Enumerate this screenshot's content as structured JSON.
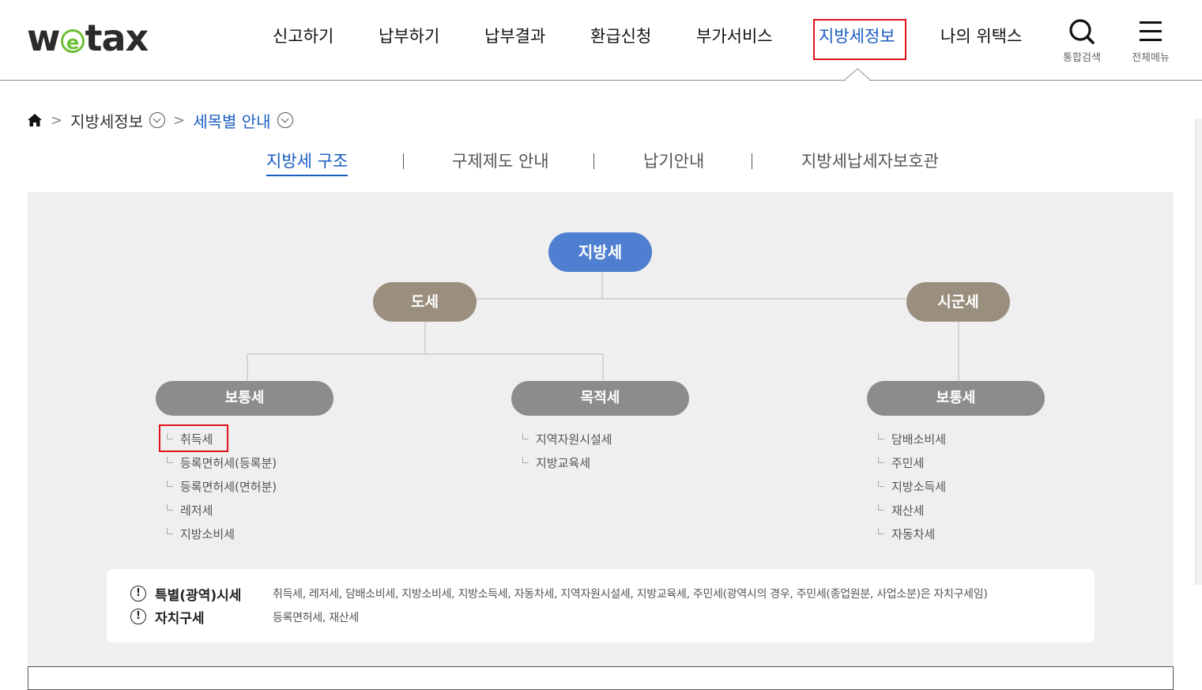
{
  "header": {
    "logo": {
      "pre": "w",
      "e": "e",
      "post": "tax"
    },
    "nav": [
      {
        "label": "신고하기"
      },
      {
        "label": "납부하기"
      },
      {
        "label": "납부결과"
      },
      {
        "label": "환급신청"
      },
      {
        "label": "부가서비스"
      },
      {
        "label": "지방세정보",
        "active": true
      },
      {
        "label": "나의 위택스"
      }
    ],
    "search_label": "통합검색",
    "menu_label": "전체메뉴",
    "search_icon": "search-icon",
    "menu_icon": "hamburger-icon"
  },
  "breadcrumb": {
    "home_icon": "home-icon",
    "level1": "지방세정보",
    "level2": "세목별 안내"
  },
  "tabs": [
    {
      "label": "지방세 구조",
      "active": true
    },
    {
      "label": "구제제도 안내"
    },
    {
      "label": "납기안내"
    },
    {
      "label": "지방세납세자보호관"
    }
  ],
  "tree": {
    "root": "지방세",
    "branches": {
      "do": "도세",
      "sigun": "시군세"
    },
    "groups": {
      "do_general": {
        "title": "보통세",
        "items": [
          "취득세",
          "등록면허세(등록분)",
          "등록면허세(면허분)",
          "레저세",
          "지방소비세"
        ]
      },
      "do_purpose": {
        "title": "목적세",
        "items": [
          "지역자원시설세",
          "지방교육세"
        ]
      },
      "sigun_general": {
        "title": "보통세",
        "items": [
          "담배소비세",
          "주민세",
          "지방소득세",
          "재산세",
          "자동차세"
        ]
      }
    }
  },
  "notice": {
    "rows": [
      {
        "icon": "!",
        "title": "특별(광역)시세",
        "text": "취득세, 레저세, 담배소비세, 지방소비세, 지방소득세, 자동차세, 지역자원시설세, 지방교육세, 주민세(광역시의 경우, 주민세(종업원분, 사업소분)은 자치구세임)"
      },
      {
        "icon": "!",
        "title": "자치구세",
        "text": "등록면허세, 재산세"
      }
    ]
  },
  "colors": {
    "accent_blue": "#1a5dc2",
    "root_pill": "#4e7fd0",
    "branch_pill": "#9a8f7f",
    "group_pill": "#8c8c8c",
    "highlight_red": "#e0121b",
    "logo_green": "#6cbf35"
  }
}
